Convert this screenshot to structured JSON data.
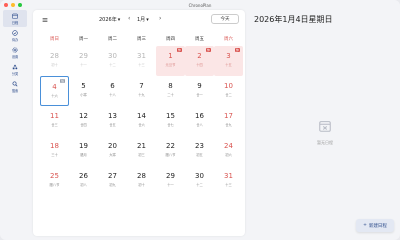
{
  "window": {
    "title": "ChronoPlan"
  },
  "sidebar": {
    "items": [
      {
        "label": "日程",
        "icon": "calendar-icon",
        "active": true
      },
      {
        "label": "待办",
        "icon": "check-circle-icon",
        "active": false
      },
      {
        "label": "设置",
        "icon": "gear-icon",
        "active": false
      },
      {
        "label": "分类",
        "icon": "category-icon",
        "active": false
      },
      {
        "label": "搜索",
        "icon": "search-icon",
        "active": false
      }
    ]
  },
  "toolbar": {
    "year": "2026年",
    "month": "1月",
    "today_label": "今天"
  },
  "weekdays": [
    "周日",
    "周一",
    "周二",
    "周三",
    "周四",
    "周五",
    "周六"
  ],
  "weeks": [
    [
      {
        "num": "28",
        "sub": "初十",
        "other": true
      },
      {
        "num": "29",
        "sub": "十一",
        "other": true
      },
      {
        "num": "30",
        "sub": "十二",
        "other": true
      },
      {
        "num": "31",
        "sub": "十三",
        "other": true
      },
      {
        "num": "1",
        "sub": "元旦节",
        "holiday": true,
        "badge": "休"
      },
      {
        "num": "2",
        "sub": "十四",
        "holiday": true,
        "badge": "休"
      },
      {
        "num": "3",
        "sub": "十五",
        "holiday": true,
        "badge": "休"
      }
    ],
    [
      {
        "num": "4",
        "sub": "十六",
        "today": true,
        "badge": "班",
        "badge_work": true
      },
      {
        "num": "5",
        "sub": "小寒"
      },
      {
        "num": "6",
        "sub": "十八"
      },
      {
        "num": "7",
        "sub": "十九"
      },
      {
        "num": "8",
        "sub": "二十"
      },
      {
        "num": "9",
        "sub": "廿一"
      },
      {
        "num": "10",
        "sub": "廿二",
        "weekend": true
      }
    ],
    [
      {
        "num": "11",
        "sub": "廿三",
        "weekend": true
      },
      {
        "num": "12",
        "sub": "廿四"
      },
      {
        "num": "13",
        "sub": "廿五"
      },
      {
        "num": "14",
        "sub": "廿六"
      },
      {
        "num": "15",
        "sub": "廿七"
      },
      {
        "num": "16",
        "sub": "廿八"
      },
      {
        "num": "17",
        "sub": "廿九",
        "weekend": true
      }
    ],
    [
      {
        "num": "18",
        "sub": "三十",
        "weekend": true
      },
      {
        "num": "19",
        "sub": "腊月"
      },
      {
        "num": "20",
        "sub": "大寒"
      },
      {
        "num": "21",
        "sub": "初三"
      },
      {
        "num": "22",
        "sub": "腊八节"
      },
      {
        "num": "23",
        "sub": "初五"
      },
      {
        "num": "24",
        "sub": "初六",
        "weekend": true
      }
    ],
    [
      {
        "num": "25",
        "sub": "腊八节",
        "weekend": true
      },
      {
        "num": "26",
        "sub": "初八"
      },
      {
        "num": "27",
        "sub": "初九"
      },
      {
        "num": "28",
        "sub": "初十"
      },
      {
        "num": "29",
        "sub": "十一"
      },
      {
        "num": "30",
        "sub": "十二"
      },
      {
        "num": "31",
        "sub": "十三",
        "weekend": true
      }
    ]
  ],
  "detail": {
    "date_title": "2026年1月4日星期日",
    "empty_text": "暂无日程",
    "new_button": "新建日程"
  },
  "colors": {
    "accent": "#2b4a8a",
    "holiday": "#d9534f",
    "today_border": "#4a90d9"
  }
}
